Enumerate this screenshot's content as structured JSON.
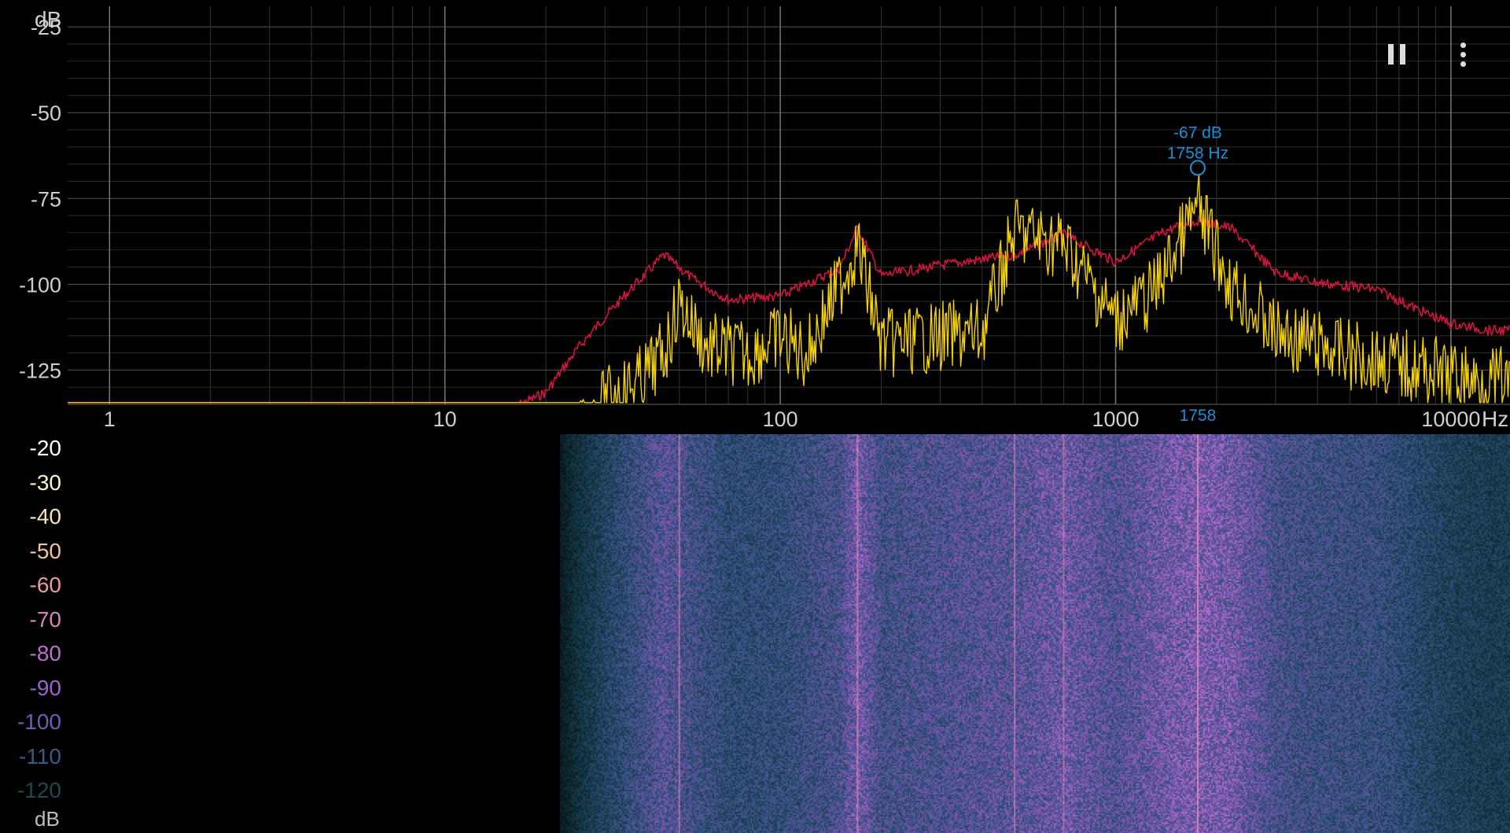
{
  "spectrum": {
    "y_unit": "dB",
    "x_unit": "Hz",
    "y_ticks": [
      "-25",
      "-50",
      "-75",
      "-100",
      "-125"
    ],
    "x_ticks": [
      "1",
      "10",
      "100",
      "1000",
      "10000"
    ],
    "peak": {
      "level_label": "-67 dB",
      "freq_label": "1758 Hz",
      "axis_marker": "1758",
      "freq_hz": 1758,
      "level_db": -67
    },
    "colors": {
      "current": "#f5d200",
      "peak_hold": "#d4143c",
      "marker": "#1a8fd8",
      "grid": "#5a5a5a",
      "background": "#000000"
    }
  },
  "chart_data": {
    "type": "line",
    "title": "",
    "xlabel": "Hz",
    "ylabel": "dB",
    "x_scale": "log",
    "xlim": [
      0.75,
      15000
    ],
    "ylim": [
      -135,
      -19
    ],
    "grid": true,
    "series": [
      {
        "x": [
          0.75,
          16,
          20,
          25,
          30,
          35,
          45,
          55,
          70,
          100,
          150,
          170,
          200,
          300,
          500,
          700,
          1000,
          1400,
          1758,
          2200,
          3000,
          4000,
          6000,
          8000,
          10000,
          13000,
          15000
        ],
        "y": [
          -134.5,
          -134.5,
          -130,
          -117,
          -108,
          -101,
          -90,
          -97,
          -103,
          -102,
          -94,
          -82,
          -96,
          -93,
          -90,
          -84,
          -92,
          -83,
          -80,
          -82,
          -95,
          -98,
          -100,
          -106,
          -110,
          -112,
          -112
        ]
      },
      {
        "x": [
          0.75,
          25,
          30,
          38,
          45,
          50,
          60,
          80,
          100,
          120,
          170,
          200,
          300,
          400,
          500,
          700,
          1000,
          1300,
          1758,
          2200,
          3000,
          5000,
          8000,
          12000,
          15000
        ],
        "y": [
          -134.5,
          -134.5,
          -124,
          -118,
          -110,
          -95,
          -108,
          -110,
          -105,
          -110,
          -78,
          -107,
          -105,
          -104,
          -74,
          -78,
          -100,
          -92,
          -67,
          -90,
          -104,
          -110,
          -114,
          -118,
          -118
        ]
      }
    ]
  },
  "spectrogram": {
    "scale_unit": "dB",
    "scale_labels": [
      {
        "text": "-20",
        "color": "#ffffff"
      },
      {
        "text": "-30",
        "color": "#fff5c8"
      },
      {
        "text": "-40",
        "color": "#f6e4b4"
      },
      {
        "text": "-50",
        "color": "#efc4a0"
      },
      {
        "text": "-60",
        "color": "#e89aa0"
      },
      {
        "text": "-70",
        "color": "#d784b4"
      },
      {
        "text": "-80",
        "color": "#bb6fc9"
      },
      {
        "text": "-90",
        "color": "#9a62d2"
      },
      {
        "text": "-100",
        "color": "#6f5bb8"
      },
      {
        "text": "-110",
        "color": "#3a5a87"
      },
      {
        "text": "-120",
        "color": "#1d4a4c"
      }
    ]
  },
  "toolbar": {
    "pause_icon": "pause-icon",
    "menu_icon": "more-vertical-icon"
  }
}
